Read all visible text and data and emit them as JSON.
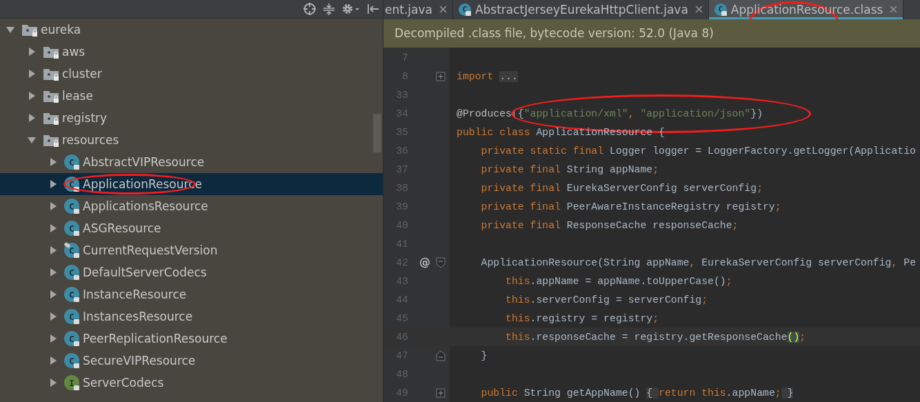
{
  "tabs": [
    {
      "label": "ent.java",
      "selected": false
    },
    {
      "label": "AbstractJerseyEurekaHttpClient.java",
      "icon_letter": "C",
      "selected": false
    },
    {
      "label": "ApplicationResource.class",
      "icon_letter": "C",
      "selected": true,
      "circled": true
    }
  ],
  "banner": "Decompiled .class file, bytecode version: 52.0 (Java 8)",
  "tree": [
    {
      "label": "eureka",
      "kind": "folder",
      "expanded": true,
      "selected": false,
      "children": [
        {
          "label": "aws",
          "kind": "folder",
          "expanded": false,
          "selected": false
        },
        {
          "label": "cluster",
          "kind": "folder",
          "expanded": false,
          "selected": false
        },
        {
          "label": "lease",
          "kind": "folder",
          "expanded": false,
          "selected": false
        },
        {
          "label": "registry",
          "kind": "folder",
          "expanded": false,
          "selected": false
        },
        {
          "label": "resources",
          "kind": "folder",
          "expanded": true,
          "selected": false,
          "children": [
            {
              "label": "AbstractVIPResource",
              "kind": "abstract-class",
              "icon_letter": "C",
              "expanded": false,
              "selected": false
            },
            {
              "label": "ApplicationResource",
              "kind": "class",
              "icon_letter": "C",
              "expanded": false,
              "selected": true,
              "circled": true
            },
            {
              "label": "ApplicationsResource",
              "kind": "class",
              "icon_letter": "C",
              "expanded": false,
              "selected": false
            },
            {
              "label": "ASGResource",
              "kind": "class",
              "icon_letter": "C",
              "expanded": false,
              "selected": false
            },
            {
              "label": "CurrentRequestVersion",
              "kind": "final-class",
              "icon_letter": "C",
              "expanded": false,
              "selected": false
            },
            {
              "label": "DefaultServerCodecs",
              "kind": "class",
              "icon_letter": "C",
              "expanded": false,
              "selected": false
            },
            {
              "label": "InstanceResource",
              "kind": "class",
              "icon_letter": "C",
              "expanded": false,
              "selected": false
            },
            {
              "label": "InstancesResource",
              "kind": "class",
              "icon_letter": "C",
              "expanded": false,
              "selected": false
            },
            {
              "label": "PeerReplicationResource",
              "kind": "class",
              "icon_letter": "C",
              "expanded": false,
              "selected": false
            },
            {
              "label": "SecureVIPResource",
              "kind": "class",
              "icon_letter": "C",
              "expanded": false,
              "selected": false
            },
            {
              "label": "ServerCodecs",
              "kind": "interface",
              "icon_letter": "I",
              "expanded": false,
              "selected": false
            }
          ]
        }
      ]
    }
  ],
  "code": [
    {
      "number": "7"
    },
    {
      "number": "8",
      "collapsed": true,
      "tokens": [
        {
          "kind": "keyword",
          "text": "import "
        },
        {
          "kind": "folded",
          "text": "..."
        }
      ]
    },
    {
      "number": "33"
    },
    {
      "number": "34",
      "circled": true,
      "tokens": [
        {
          "kind": "annotation",
          "text": "@Produces"
        },
        {
          "kind": "plain",
          "text": "({"
        },
        {
          "kind": "string",
          "text": "\"application/xml\""
        },
        {
          "kind": "keyword",
          "text": ", "
        },
        {
          "kind": "string",
          "text": "\"application/json\""
        },
        {
          "kind": "plain",
          "text": "})"
        }
      ]
    },
    {
      "number": "35",
      "tokens": [
        {
          "kind": "keyword",
          "text": "public class "
        },
        {
          "kind": "plain",
          "text": "ApplicationResource {"
        }
      ]
    },
    {
      "number": "36",
      "tokens": [
        {
          "kind": "keyword",
          "text": "    private static final "
        },
        {
          "kind": "plain",
          "text": "Logger logger = LoggerFactory.getLogger(Applicatio"
        }
      ]
    },
    {
      "number": "37",
      "tokens": [
        {
          "kind": "keyword",
          "text": "    private final "
        },
        {
          "kind": "plain",
          "text": "String appName"
        },
        {
          "kind": "keyword",
          "text": ";"
        }
      ]
    },
    {
      "number": "38",
      "tokens": [
        {
          "kind": "keyword",
          "text": "    private final "
        },
        {
          "kind": "plain",
          "text": "EurekaServerConfig serverConfig"
        },
        {
          "kind": "keyword",
          "text": ";"
        }
      ]
    },
    {
      "number": "39",
      "tokens": [
        {
          "kind": "keyword",
          "text": "    private final "
        },
        {
          "kind": "plain",
          "text": "PeerAwareInstanceRegistry registry"
        },
        {
          "kind": "keyword",
          "text": ";"
        }
      ]
    },
    {
      "number": "40",
      "tokens": [
        {
          "kind": "keyword",
          "text": "    private final "
        },
        {
          "kind": "plain",
          "text": "ResponseCache responseCache"
        },
        {
          "kind": "keyword",
          "text": ";"
        }
      ]
    },
    {
      "number": "41"
    },
    {
      "number": "42",
      "gutter": "@",
      "collapsed": false,
      "tokens": [
        {
          "kind": "plain",
          "text": "    ApplicationResource(String appName"
        },
        {
          "kind": "keyword",
          "text": ", "
        },
        {
          "kind": "plain",
          "text": "EurekaServerConfig serverConfig"
        },
        {
          "kind": "keyword",
          "text": ", "
        },
        {
          "kind": "plain",
          "text": "Pe"
        }
      ]
    },
    {
      "number": "43",
      "tokens": [
        {
          "kind": "keyword",
          "text": "        this"
        },
        {
          "kind": "plain",
          "text": ".appName = appName.toUpperCase()"
        },
        {
          "kind": "keyword",
          "text": ";"
        }
      ]
    },
    {
      "number": "44",
      "tokens": [
        {
          "kind": "keyword",
          "text": "        this"
        },
        {
          "kind": "plain",
          "text": ".serverConfig = serverConfig"
        },
        {
          "kind": "keyword",
          "text": ";"
        }
      ]
    },
    {
      "number": "45",
      "tokens": [
        {
          "kind": "keyword",
          "text": "        this"
        },
        {
          "kind": "plain",
          "text": ".registry = registry"
        },
        {
          "kind": "keyword",
          "text": ";"
        }
      ]
    },
    {
      "number": "46",
      "current": true,
      "tokens": [
        {
          "kind": "keyword",
          "text": "        this"
        },
        {
          "kind": "plain",
          "text": ".responseCache = registry.getResponseCache"
        },
        {
          "kind": "match",
          "text": "()"
        },
        {
          "kind": "keyword",
          "text": ";"
        }
      ]
    },
    {
      "number": "47",
      "block_end": true,
      "tokens": [
        {
          "kind": "plain",
          "text": "    }"
        }
      ]
    },
    {
      "number": "48"
    },
    {
      "number": "49",
      "collapsed": true,
      "tokens": [
        {
          "kind": "keyword",
          "text": "    public "
        },
        {
          "kind": "plain",
          "text": "String getAppName() "
        },
        {
          "kind": "folded",
          "text": "{ "
        },
        {
          "kind": "keyword",
          "text": "return this"
        },
        {
          "kind": "plain",
          "text": ".appName"
        },
        {
          "kind": "keyword",
          "text": ";"
        },
        {
          "kind": "folded",
          "text": " }"
        }
      ]
    }
  ]
}
